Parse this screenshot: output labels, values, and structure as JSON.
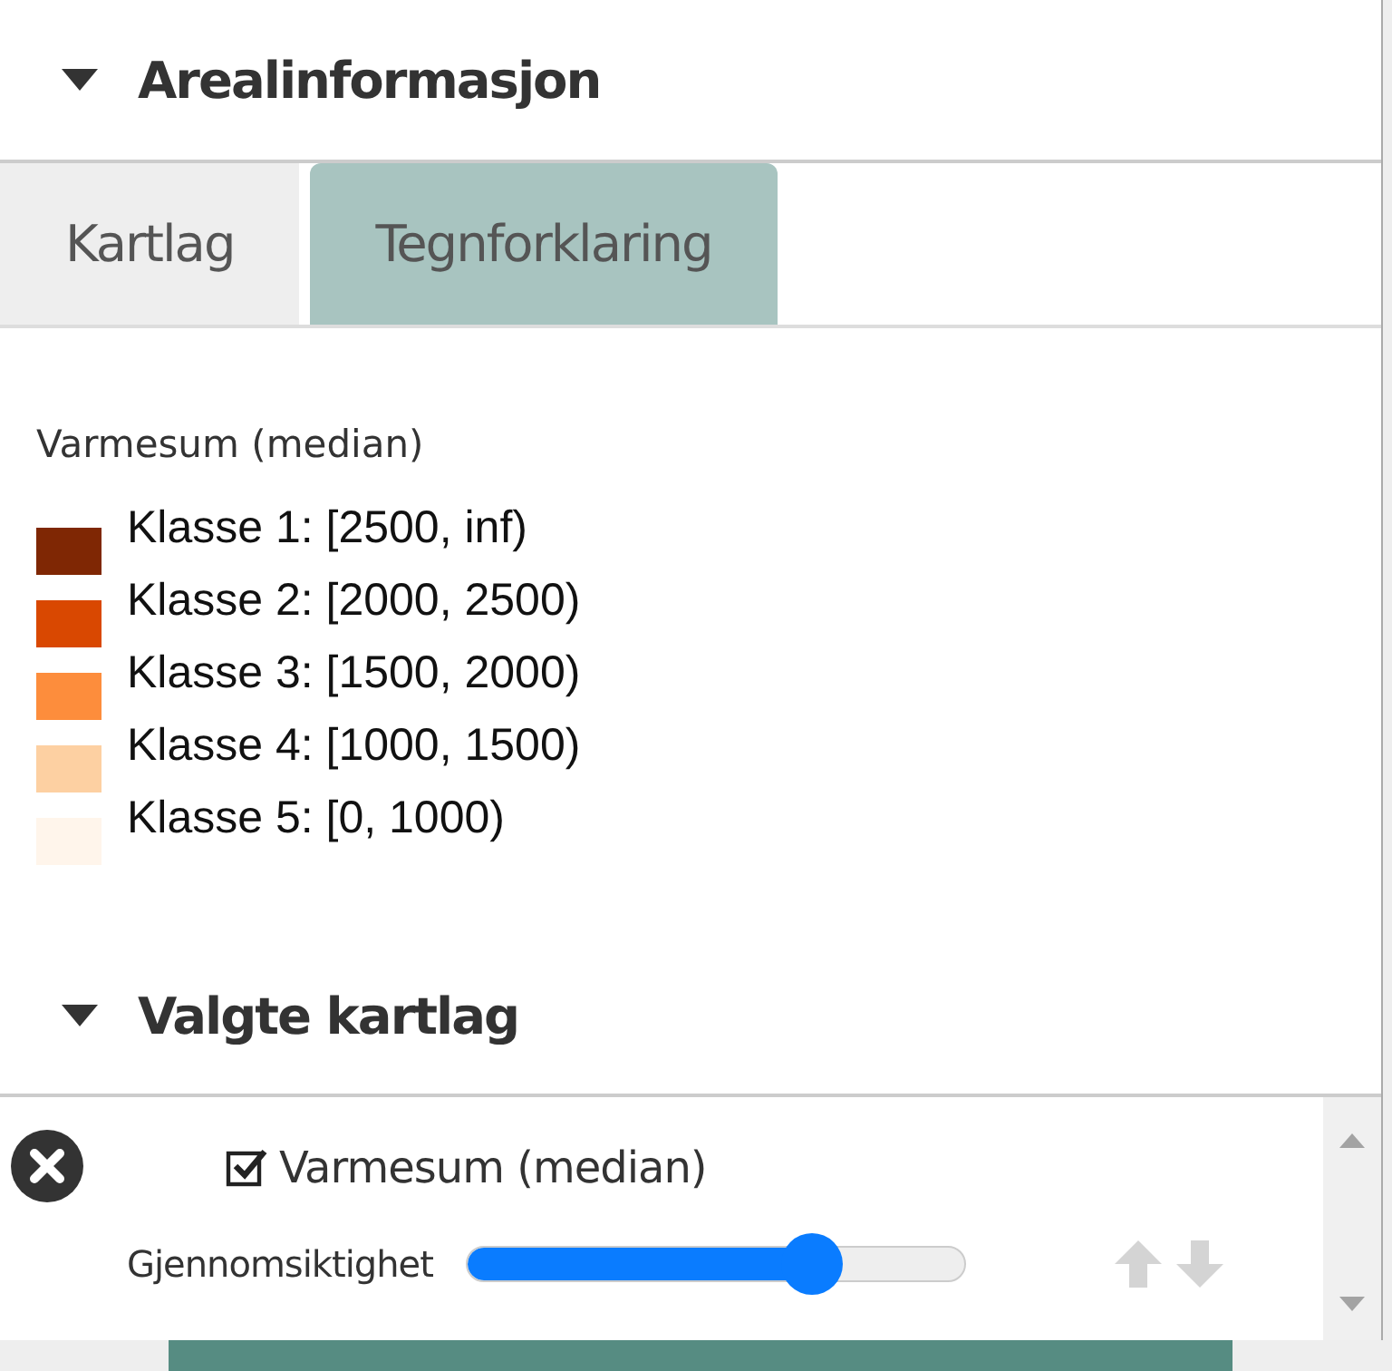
{
  "section": {
    "title": "Arealinformasjon",
    "expanded": true
  },
  "tabs": [
    {
      "label": "Kartlag",
      "selected": false
    },
    {
      "label": "Tegnforklaring",
      "selected": true
    }
  ],
  "legend": {
    "title": "Varmesum (median)",
    "items": [
      {
        "label": "Klasse 1: [2500, inf)",
        "color": "#7f2704"
      },
      {
        "label": "Klasse 2: [2000, 2500)",
        "color": "#d94801"
      },
      {
        "label": "Klasse 3: [1500, 2000)",
        "color": "#fd8d3c"
      },
      {
        "label": "Klasse 4: [1000, 1500)",
        "color": "#fdd0a2"
      },
      {
        "label": "Klasse 5: [0, 1000)",
        "color": "#fff5eb"
      }
    ]
  },
  "selected_section": {
    "title": "Valgte kartlag",
    "expanded": true
  },
  "layers": [
    {
      "name": "Varmesum (median)",
      "checked": true,
      "opacity_label": "Gjennomsiktighet",
      "level": 0.72
    }
  ]
}
